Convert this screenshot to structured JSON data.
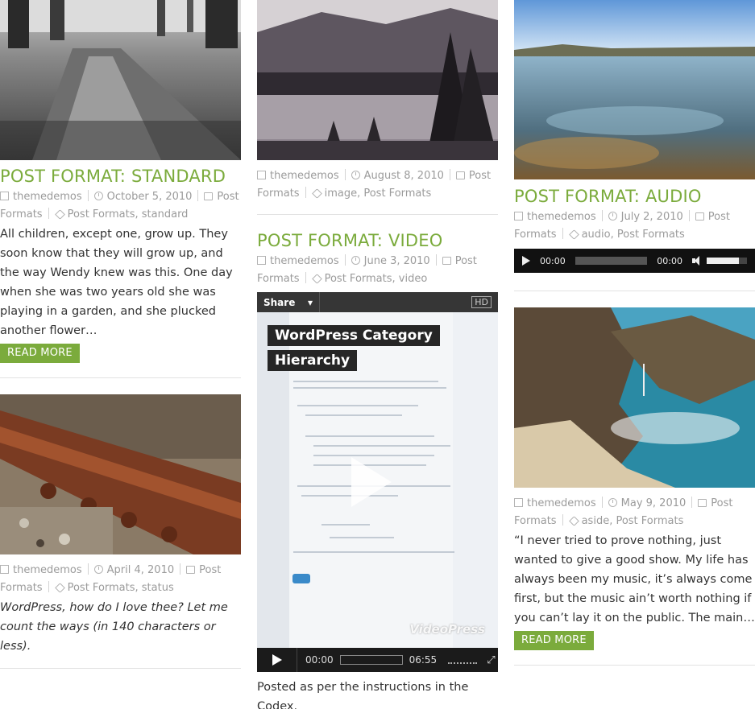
{
  "posts": {
    "standard": {
      "title": "POST FORMAT: STANDARD",
      "author": "themedemos",
      "date": "October 5, 2010",
      "category_a": "Post",
      "category_b": "Formats",
      "tags": "Post Formats, standard",
      "excerpt": "All children, except one, grow up. They soon know that they will grow up, and the way Wendy knew was this. One day when she was two years old she was playing in a garden, and she plucked another flower…",
      "button": "READ MORE"
    },
    "status": {
      "author": "themedemos",
      "date": "April 4, 2010",
      "category_a": "Post",
      "category_b": "Formats",
      "tags": "Post Formats, status",
      "excerpt": "WordPress, how do I love thee? Let me count the ways (in 140 characters or less)."
    },
    "image": {
      "author": "themedemos",
      "date": "August 8, 2010",
      "category_a": "Post",
      "category_b": "Formats",
      "tags": "image, Post Formats"
    },
    "video": {
      "title": "POST FORMAT: VIDEO",
      "author": "themedemos",
      "date": "June 3, 2010",
      "category_a": "Post",
      "category_b": "Formats",
      "tags": "Post Formats, video",
      "player": {
        "share": "Share",
        "hd": "HD",
        "title_line1": "WordPress Category",
        "title_line2": "Hierarchy",
        "watermark": "VideoPress",
        "time_current": "00:00",
        "time_total": "06:55"
      },
      "caption": "Posted as per the instructions in the Codex."
    },
    "audio": {
      "title": "POST FORMAT: AUDIO",
      "author": "themedemos",
      "date": "July 2, 2010",
      "category_a": "Post",
      "category_b": "Formats",
      "tags": "audio, Post Formats",
      "player": {
        "time_current": "00:00",
        "time_total": "00:00",
        "progress": 0,
        "volume": 0.8
      }
    },
    "aside": {
      "author": "themedemos",
      "date": "May 9, 2010",
      "category_a": "Post",
      "category_b": "Formats",
      "tags": "aside, Post Formats",
      "excerpt": "“I never tried to prove nothing, just wanted to give a good show. My life has always been my music, it’s always come first, but the music ain’t worth nothing if you can’t lay it on the public. The main…",
      "button": "READ MORE"
    }
  },
  "colors": {
    "accent": "#7bab3c",
    "meta": "#9b9b9b",
    "text": "#333333"
  }
}
